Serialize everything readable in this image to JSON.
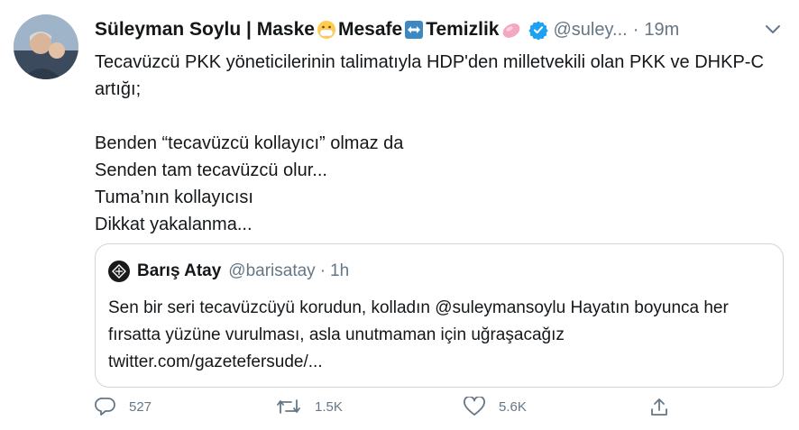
{
  "tweet": {
    "display_name": "Süleyman Soylu | Maske",
    "name_part2": "Mesafe",
    "name_part3": "Temizlik",
    "handle": "@suley...",
    "separator": "·",
    "time": "19m",
    "text": "Tecavüzcü PKK yöneticilerinin talimatıyla HDP'den milletvekili olan PKK ve DHKP-C artığı;\n\nBenden “tecavüzcü kollayıcı” olmaz da\nSenden tam tecavüzcü olur...\nTuma’nın kollayıcısı\nDikkat yakalanma..."
  },
  "quote": {
    "name": "Barış Atay",
    "handle": "@barisatay",
    "separator": "·",
    "time": "1h",
    "text": "Sen bir seri tecavüzcüyü korudun, kolladın @suleymansoylu Hayatın boyunca her fırsatta yüzüne vurulması, asla unutmaman için uğraşacağız twitter.com/gazetefersude/..."
  },
  "actions": {
    "reply_count": "527",
    "retweet_count": "1.5K",
    "like_count": "5.6K"
  },
  "colors": {
    "accent": "#1da1f2",
    "secondary_text": "#657786",
    "border": "#ccd6dd"
  },
  "icons": [
    "mask-emoji-icon",
    "left-right-arrow-icon",
    "soap-icon",
    "verified-badge-icon",
    "chevron-down-icon",
    "reply-icon",
    "retweet-icon",
    "like-icon",
    "share-icon"
  ]
}
